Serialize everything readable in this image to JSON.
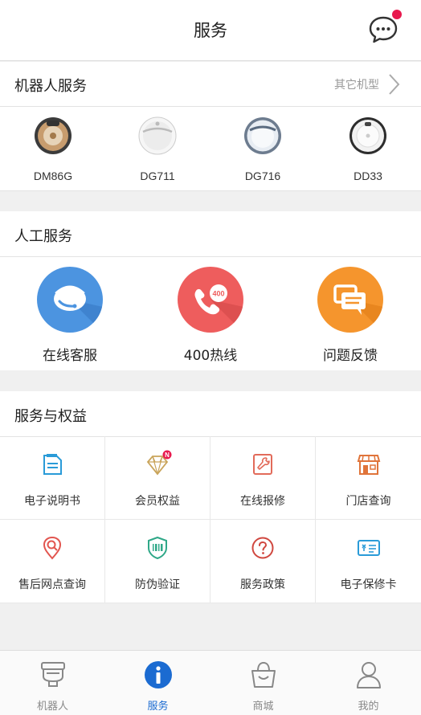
{
  "header": {
    "title": "服务",
    "message_icon": "chat-bubble-icon"
  },
  "robot_service": {
    "title": "机器人服务",
    "other_models": "其它机型",
    "robots": [
      {
        "name": "DM86G",
        "color": "#b8895e"
      },
      {
        "name": "DG711",
        "color": "#e9e9e9"
      },
      {
        "name": "DG716",
        "color": "#dfe6ee"
      },
      {
        "name": "DD33",
        "color": "#f4f4f4"
      }
    ]
  },
  "manual_service": {
    "title": "人工服务",
    "items": [
      {
        "label": "在线客服",
        "icon": "customer-service-icon",
        "color": "#4c94e0"
      },
      {
        "label": "400热线",
        "icon": "phone-hotline-icon",
        "color": "#ee5d5d"
      },
      {
        "label": "问题反馈",
        "icon": "feedback-chat-icon",
        "color": "#f5952d"
      }
    ],
    "hotline_badge": "400"
  },
  "benefits": {
    "title": "服务与权益",
    "items": [
      {
        "label": "电子说明书",
        "icon": "manual-icon",
        "color": "#2a9bd8"
      },
      {
        "label": "会员权益",
        "icon": "diamond-icon",
        "color": "#c9a45a",
        "badge": "N"
      },
      {
        "label": "在线报修",
        "icon": "wrench-icon",
        "color": "#e26b5a"
      },
      {
        "label": "门店查询",
        "icon": "store-icon",
        "color": "#e0743a"
      },
      {
        "label": "售后网点查询",
        "icon": "location-search-icon",
        "color": "#e2554f"
      },
      {
        "label": "防伪验证",
        "icon": "barcode-shield-icon",
        "color": "#2fa888"
      },
      {
        "label": "服务政策",
        "icon": "question-icon",
        "color": "#d0473f"
      },
      {
        "label": "电子保修卡",
        "icon": "warranty-card-icon",
        "color": "#2a9bd8"
      }
    ]
  },
  "tabbar": {
    "tabs": [
      {
        "label": "机器人",
        "icon": "robot-icon",
        "active": false
      },
      {
        "label": "服务",
        "icon": "info-icon",
        "active": true
      },
      {
        "label": "商城",
        "icon": "shopping-bag-icon",
        "active": false
      },
      {
        "label": "我的",
        "icon": "person-icon",
        "active": false
      }
    ],
    "active_color": "#1b6bd1"
  }
}
